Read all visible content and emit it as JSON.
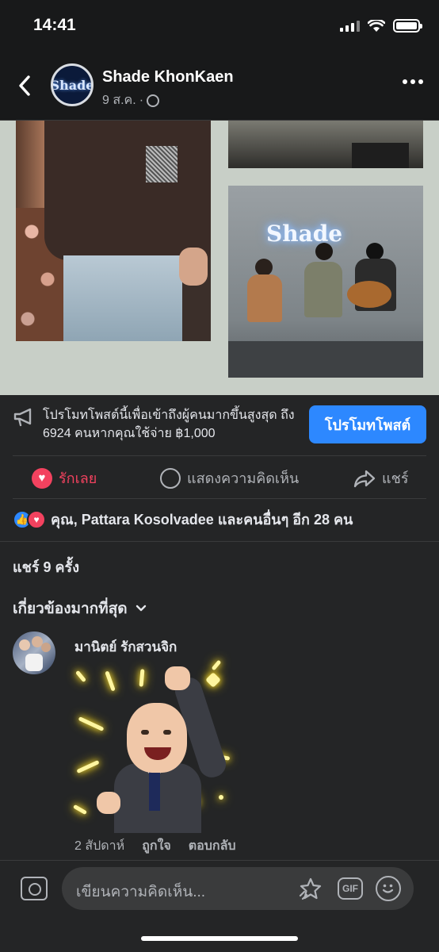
{
  "status_bar": {
    "time": "14:41"
  },
  "header": {
    "page_name": "Shade KhonKaen",
    "date": "9 ส.ค.",
    "dot": "·",
    "avatar_text": "Shade"
  },
  "photos": {
    "sign_text": "Shade"
  },
  "promotion": {
    "text": "โปรโมทโพสต์นี้เพื่อเข้าถึงผู้คนมากขึ้นสูงสุด ถึง 6924 คนหากคุณใช้จ่าย ฿1,000",
    "button": "โปรโมทโพสต์"
  },
  "actions": {
    "like": "รักเลย",
    "comment": "แสดงความคิดเห็น",
    "share": "แชร์"
  },
  "reactions": {
    "text": "คุณ, Pattara Kosolvadee และคนอื่นๆ อีก 28 คน"
  },
  "shares": {
    "text": "แชร์ 9 ครั้ง"
  },
  "comments": {
    "sort_label": "เกี่ยวข้องมากที่สุด",
    "items": [
      {
        "author": "มานิตย์ รักสวนจิก",
        "time": "2 สัปดาห์",
        "like_label": "ถูกใจ",
        "reply_label": "ตอบกลับ"
      }
    ]
  },
  "composer": {
    "placeholder": "เขียนความคิดเห็น...",
    "gif_label": "GIF"
  },
  "colors": {
    "background": "#242526",
    "accent_blue": "#2d88ff",
    "love_red": "#f3425f",
    "secondary_text": "#b0b3b8"
  }
}
